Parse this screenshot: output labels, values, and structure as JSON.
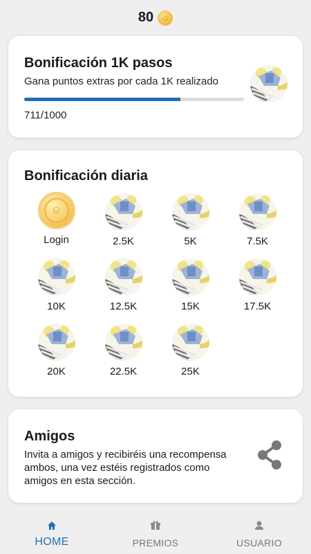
{
  "header": {
    "points": "80",
    "coin_icon": "coin-icon"
  },
  "step_bonus": {
    "title": "Bonificación 1K pasos",
    "subtitle": "Gana puntos extras por cada 1K realizado",
    "progress_value": 711,
    "progress_max": 1000,
    "progress_text": "711/1000",
    "accent_color": "#1f6fb5"
  },
  "daily_bonus": {
    "title": "Bonificación diaria",
    "items": [
      {
        "label": "Login",
        "icon": "coin-icon"
      },
      {
        "label": "2.5K",
        "icon": "badge-icon"
      },
      {
        "label": "5K",
        "icon": "badge-icon"
      },
      {
        "label": "7.5K",
        "icon": "badge-icon"
      },
      {
        "label": "10K",
        "icon": "badge-icon"
      },
      {
        "label": "12.5K",
        "icon": "badge-icon"
      },
      {
        "label": "15K",
        "icon": "badge-icon"
      },
      {
        "label": "17.5K",
        "icon": "badge-icon"
      },
      {
        "label": "20K",
        "icon": "badge-icon"
      },
      {
        "label": "22.5K",
        "icon": "badge-icon"
      },
      {
        "label": "25K",
        "icon": "badge-icon"
      }
    ]
  },
  "friends": {
    "title": "Amigos",
    "text": "Invita a amigos y recibiréis una recompensa ambos, una vez estéis registrados como amigos en esta sección.",
    "share_icon": "share-icon"
  },
  "nav": {
    "items": [
      {
        "label": "HOME",
        "icon": "home-icon",
        "active": true
      },
      {
        "label": "PREMIOS",
        "icon": "gift-icon",
        "active": false
      },
      {
        "label": "USUARIO",
        "icon": "user-icon",
        "active": false
      }
    ]
  }
}
